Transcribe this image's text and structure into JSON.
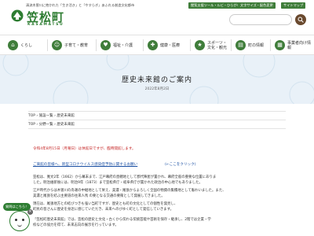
{
  "header": {
    "tagline": "清流木曽川に抱かれた「生き活き」と「やすらぎ」あふれる創造文化都市",
    "logo_text": "笠松町",
    "logo_sub": "KASAMATSU",
    "utility_links": [
      "閲覧支援ツール・ルビ・ひらがな",
      "文字サイズ・配色変更",
      "サイトマップ"
    ],
    "search_icon": "search-icon"
  },
  "nav": [
    {
      "label": "くらし",
      "icon": "home-icon"
    },
    {
      "label": "子育て・教育",
      "icon": "child-icon"
    },
    {
      "label": "福祉・介護",
      "icon": "care-icon"
    },
    {
      "label": "健康・医療",
      "icon": "health-icon"
    },
    {
      "label": "スポーツ・文化・観光",
      "icon": "sports-icon"
    },
    {
      "label": "町の情報",
      "icon": "info-icon"
    },
    {
      "label": "事業者向け情報",
      "icon": "business-icon"
    }
  ],
  "hero": {
    "title": "歴史未来館のご案内",
    "date": "2022年8月2日"
  },
  "breadcrumbs": {
    "first": "TOP › 施設一覧 › 歴史未来館",
    "second": "TOP › 分野一覧 › 歴史未来館"
  },
  "content": {
    "notice": "令和4年8月15日（月曜日）は休館日ですが、臨時開館します。",
    "link": "ご来館の皆様へ、新型コロナウイルス感染症予防に関するお願い",
    "link_note": "(←ここをクリック)",
    "paragraphs": [
      "笠松は、寛文2年（1662）から幕末まで、江戸幕府の直轄地として郡代陣屋が置かれ、幕府全般の重要な位置にありま",
      "した。明治維新後には、明治9年（1873）まで笠松県庁・岐阜県庁が置かれた政治の中心地でもありました。",
      "江戸時代からは木曽川の舟運の中継地として栄え、美濃・尾張からよろしく全国の物資の集積地として賑わいました。また、",
      "美濃と尾張を結ぶ主要道の往来人馬 の要となる交通の要衝として発展してきました。",
      "現在は、尾張地方との結びつきも強い当町ですが、歴史とも町の文化としての個性を発見し、",
      "町民の皆さんに歴史を身近に感じていただき、未来へのびゆく町として発信していきます。",
      "「笠松町歴史未来館」では、笠松の歴史と文化・古くから伝わる伝統芸能や芸術を保存・継承し、2階では企業・学",
      "校などの協力を得て、未来志向の展示を行っています。"
    ]
  },
  "chat": {
    "bubble": "質問はこちら！"
  },
  "colors": {
    "brand_green": "#2e7d32",
    "hero_bg": "#e9f1f8",
    "notice_red": "#c62828",
    "link_blue": "#1a4fa3"
  }
}
